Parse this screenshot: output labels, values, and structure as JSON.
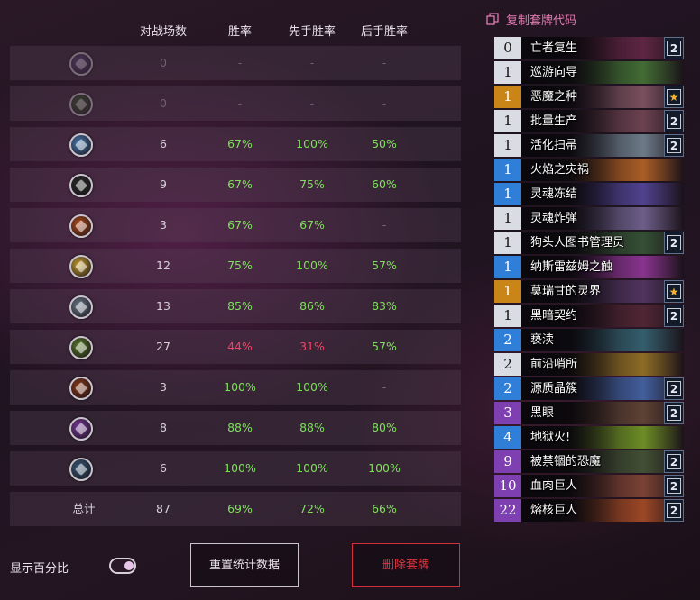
{
  "header": {
    "games": "对战场数",
    "winrate": "胜率",
    "first": "先手胜率",
    "second": "后手胜率"
  },
  "stats_rows": [
    {
      "icon": "mage-class-icon",
      "color": "#6a4a8a",
      "games": "0",
      "winrate": "-",
      "first": "-",
      "second": "-",
      "dim": true
    },
    {
      "icon": "hunter-class-icon",
      "color": "#3a5a2a",
      "games": "0",
      "winrate": "-",
      "first": "-",
      "second": "-",
      "dim": true
    },
    {
      "icon": "shaman-class-icon",
      "color": "#4a7ab0",
      "games": "6",
      "winrate": "67%",
      "first": "100%",
      "second": "50%"
    },
    {
      "icon": "rogue-class-icon",
      "color": "#2a2a2a",
      "games": "9",
      "winrate": "67%",
      "first": "75%",
      "second": "60%"
    },
    {
      "icon": "warrior-class-icon",
      "color": "#b04a1a",
      "games": "3",
      "winrate": "67%",
      "first": "67%",
      "second": "-"
    },
    {
      "icon": "paladin-class-icon",
      "color": "#c8a030",
      "games": "12",
      "winrate": "75%",
      "first": "100%",
      "second": "57%"
    },
    {
      "icon": "priest-class-icon",
      "color": "#6a7a8a",
      "games": "13",
      "winrate": "85%",
      "first": "86%",
      "second": "83%"
    },
    {
      "icon": "druid-class-icon",
      "color": "#5a7a2a",
      "games": "27",
      "winrate": "44%",
      "first": "31%",
      "second": "57%"
    },
    {
      "icon": "warlock-class-icon",
      "color": "#8a3a1a",
      "games": "3",
      "winrate": "100%",
      "first": "100%",
      "second": "-"
    },
    {
      "icon": "demon-hunter-class-icon",
      "color": "#7a3a9a",
      "games": "8",
      "winrate": "88%",
      "first": "88%",
      "second": "80%"
    },
    {
      "icon": "death-knight-class-icon",
      "color": "#3a5a7a",
      "games": "6",
      "winrate": "100%",
      "first": "100%",
      "second": "100%"
    }
  ],
  "total_row": {
    "label": "总计",
    "games": "87",
    "winrate": "69%",
    "first": "72%",
    "second": "66%"
  },
  "controls": {
    "show_percent_label": "显示百分比",
    "toggle_on": true,
    "reset_label": "重置统计数据",
    "delete_label": "删除套牌"
  },
  "copy_code_label": "复制套牌代码",
  "colors": {
    "good": "#7ee05a",
    "bad": "#ef4466",
    "delete": "#e8353f",
    "accent": "#e07ab0"
  },
  "cards": [
    {
      "cost": "0",
      "name": "亡者复生",
      "rarity": "common",
      "count": "2",
      "art": "#6a2a4a"
    },
    {
      "cost": "1",
      "name": "巡游向导",
      "rarity": "common",
      "count": "",
      "art": "#4a7a3a"
    },
    {
      "cost": "1",
      "name": "恶魔之种",
      "rarity": "legendary",
      "count": "★",
      "art": "#8a5a6a"
    },
    {
      "cost": "1",
      "name": "批量生产",
      "rarity": "common",
      "count": "2",
      "art": "#7a4a5a"
    },
    {
      "cost": "1",
      "name": "活化扫帚",
      "rarity": "common",
      "count": "2",
      "art": "#7a8a9a"
    },
    {
      "cost": "1",
      "name": "火焰之灾祸",
      "rarity": "rare",
      "count": "",
      "art": "#c06a2a"
    },
    {
      "cost": "1",
      "name": "灵魂冻结",
      "rarity": "rare",
      "count": "",
      "art": "#5a4aa0"
    },
    {
      "cost": "1",
      "name": "灵魂炸弹",
      "rarity": "common",
      "count": "",
      "art": "#7a6a9a"
    },
    {
      "cost": "1",
      "name": "狗头人图书管理员",
      "rarity": "common",
      "count": "2",
      "art": "#3a5a3a"
    },
    {
      "cost": "1",
      "name": "纳斯雷兹姆之触",
      "rarity": "rare",
      "count": "",
      "art": "#9a3aa0"
    },
    {
      "cost": "1",
      "name": "莫瑞甘的灵界",
      "rarity": "legendary",
      "count": "★",
      "art": "#5a3a6a"
    },
    {
      "cost": "1",
      "name": "黑暗契约",
      "rarity": "common",
      "count": "2",
      "art": "#5a2a3a"
    },
    {
      "cost": "2",
      "name": "亵渎",
      "rarity": "rare",
      "count": "",
      "art": "#3a6a7a"
    },
    {
      "cost": "2",
      "name": "前沿哨所",
      "rarity": "common",
      "count": "",
      "art": "#a07a2a"
    },
    {
      "cost": "2",
      "name": "源质晶簇",
      "rarity": "rare",
      "count": "2",
      "art": "#4a6ab0"
    },
    {
      "cost": "3",
      "name": "黑眼",
      "rarity": "epic",
      "count": "2",
      "art": "#6a4a3a"
    },
    {
      "cost": "4",
      "name": "地狱火!",
      "rarity": "rare",
      "count": "",
      "art": "#7aa02a"
    },
    {
      "cost": "9",
      "name": "被禁锢的恐魔",
      "rarity": "epic",
      "count": "2",
      "art": "#4a5a3a"
    },
    {
      "cost": "10",
      "name": "血肉巨人",
      "rarity": "epic",
      "count": "2",
      "art": "#8a4a3a"
    },
    {
      "cost": "22",
      "name": "熔核巨人",
      "rarity": "epic",
      "count": "2",
      "art": "#b0502a"
    }
  ]
}
